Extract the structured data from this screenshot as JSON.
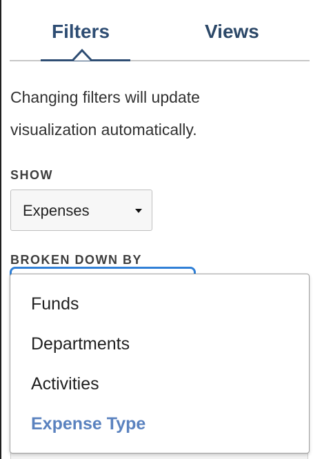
{
  "tabs": {
    "filters": "Filters",
    "views": "Views"
  },
  "info_text_line1": "Changing filters will update",
  "info_text_line2": "visualization automatically.",
  "show": {
    "label": "SHOW",
    "selected": "Expenses"
  },
  "broken_down_by": {
    "label": "BROKEN DOWN BY",
    "options": [
      {
        "label": "Funds"
      },
      {
        "label": "Departments"
      },
      {
        "label": "Activities"
      },
      {
        "label": "Expense Type"
      }
    ],
    "selected": "Expense Type"
  },
  "colors": {
    "tab_active": "#2e4d73",
    "selected_option": "#5a82bf",
    "focus_ring": "#2f7fd6"
  },
  "icons": {
    "select_caret": "caret-down-icon",
    "tab_indicator": "caret-up-icon"
  }
}
